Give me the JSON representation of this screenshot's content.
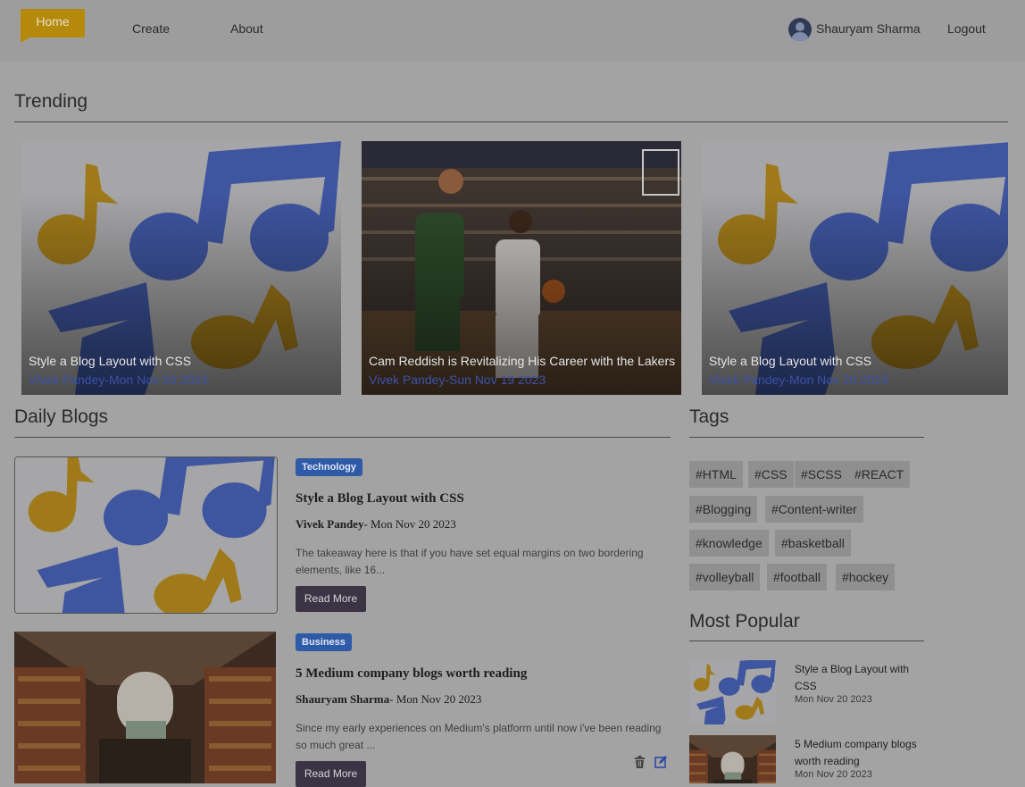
{
  "nav": {
    "home": "Home",
    "create": "Create",
    "about": "About",
    "user_name": "Shauryam Sharma",
    "logout": "Logout"
  },
  "sections": {
    "trending": "Trending",
    "daily": "Daily Blogs",
    "tags": "Tags",
    "popular": "Most Popular"
  },
  "trending": [
    {
      "title": "Style a Blog Layout with CSS",
      "meta": "Vivek Pandey-Mon Nov 20 2023",
      "image": "music-notes"
    },
    {
      "title": "Cam Reddish is Revitalizing His Career with the Lakers",
      "meta": "Vivek Pandey-Sun Nov 19 2023",
      "image": "basketball-game"
    },
    {
      "title": "Style a Blog Layout with CSS",
      "meta": "Vivek Pandey-Mon Nov 20 2023",
      "image": "music-notes"
    }
  ],
  "blogs": [
    {
      "category": "Technology",
      "title": "Style a Blog Layout with CSS",
      "author": "Vivek Pandey",
      "date": "- Mon Nov 20 2023",
      "excerpt": "The takeaway here is that if you have set equal margins on two bordering elements, like 16...",
      "button": "Read More",
      "image": "music-notes"
    },
    {
      "category": "Business",
      "title": "5 Medium company blogs worth reading",
      "author": "Shauryam Sharma",
      "date": "- Mon Nov 20 2023",
      "excerpt": "Since my early experiences on Medium's platform until now i've been reading so much great ...",
      "button": "Read More",
      "image": "library"
    }
  ],
  "tags": [
    "#HTML",
    "#CSS",
    "#SCSS",
    "#REACT",
    "#Blogging",
    "#Content-writer",
    "#knowledge",
    "#basketball",
    "#volleyball",
    "#football",
    "#hockey"
  ],
  "popular": [
    {
      "title": "Style a Blog Layout with CSS",
      "date": "Mon Nov 20 2023",
      "image": "music-notes"
    },
    {
      "title": "5 Medium company blogs worth reading",
      "date": "Mon Nov 20 2023",
      "image": "library"
    }
  ],
  "icons": {
    "delete": "trash-icon",
    "edit": "edit-icon",
    "avatar": "user-avatar-icon"
  },
  "colors": {
    "accent": "#b58a0c",
    "badge": "#2f5aa8",
    "button": "#3a3445",
    "meta": "#3b52a8"
  }
}
